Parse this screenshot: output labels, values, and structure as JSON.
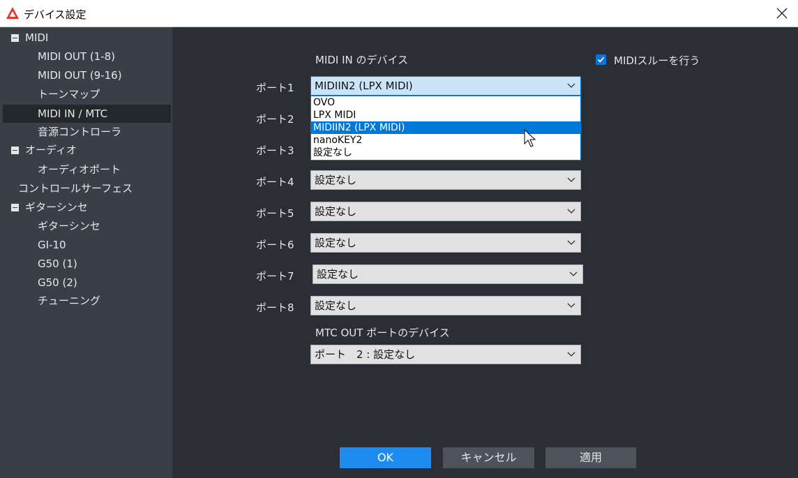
{
  "window": {
    "title": "デバイス設定"
  },
  "sidebar": {
    "items": [
      {
        "label": "MIDI"
      },
      {
        "label": "MIDI OUT (1-8)"
      },
      {
        "label": "MIDI OUT (9-16)"
      },
      {
        "label": "トーンマップ"
      },
      {
        "label": "MIDI IN / MTC"
      },
      {
        "label": "音源コントローラ"
      },
      {
        "label": "オーディオ"
      },
      {
        "label": "オーディオポート"
      },
      {
        "label": "コントロールサーフェス"
      },
      {
        "label": "ギターシンセ"
      },
      {
        "label": "ギターシンセ"
      },
      {
        "label": "GI-10"
      },
      {
        "label": "G50 (1)"
      },
      {
        "label": "G50 (2)"
      },
      {
        "label": "チューニング"
      }
    ]
  },
  "main": {
    "midi_in_heading": "MIDI IN のデバイス",
    "thru_label": "MIDIスルーを行う",
    "ports": [
      {
        "label": "ポート1",
        "value": "MIDIIN2 (LPX MIDI)"
      },
      {
        "label": "ポート2",
        "value": ""
      },
      {
        "label": "ポート3",
        "value": ""
      },
      {
        "label": "ポート4",
        "value": "設定なし"
      },
      {
        "label": "ポート5",
        "value": "設定なし"
      },
      {
        "label": "ポート6",
        "value": "設定なし"
      },
      {
        "label": "ポート7",
        "value": "設定なし"
      },
      {
        "label": "ポート8",
        "value": "設定なし"
      }
    ],
    "dropdown_options": [
      "OVO",
      "LPX MIDI",
      "MIDIIN2 (LPX MIDI)",
      "nanoKEY2",
      "設定なし"
    ],
    "mtc_heading": "MTC OUT ポートのデバイス",
    "mtc_value": "ポート　2 : 設定なし"
  },
  "buttons": {
    "ok": "OK",
    "cancel": "キャンセル",
    "apply": "適用"
  },
  "colors": {
    "accent": "#0078d7",
    "sidebar_bg": "#3a3f47",
    "main_bg": "#2b2f35"
  }
}
